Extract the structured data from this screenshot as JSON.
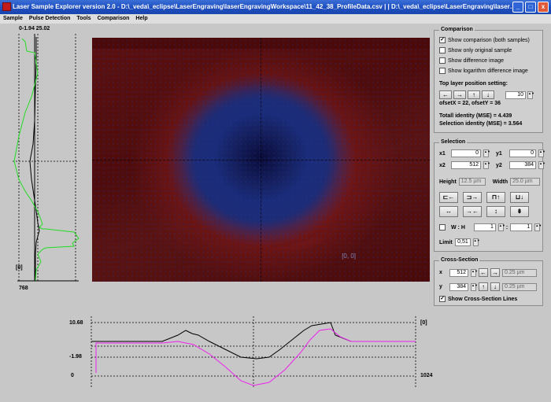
{
  "window": {
    "title": "Laser Sample Explorer version 2.0 - D:\\_veda\\_eclipse\\LaserEngraving\\laserEngravingWorkspace\\11_42_38_ProfileData.csv | | D:\\_veda\\_eclipse\\LaserEngraving\\laserEngravingWorksp...",
    "minimize": "_",
    "maximize": "□",
    "close": "x"
  },
  "menu": [
    "Sample",
    "Pulse Detection",
    "Tools",
    "Comparison",
    "Help"
  ],
  "left_profile": {
    "top_label": "0-1.94 25.02",
    "marker_label": "[0]",
    "bottom_label": "768"
  },
  "image": {
    "origin_label": "[0, 0]"
  },
  "bottom_profile": {
    "y_top": "10.68",
    "y_mid": "-1.98",
    "y_bottom": "0",
    "right_top": "[0]",
    "right_bottom": "1024"
  },
  "comparison": {
    "title": "Comparison",
    "options": [
      {
        "label": "Show comparison (both samples)",
        "checked": true
      },
      {
        "label": "Show only original sample",
        "checked": false
      },
      {
        "label": "Show difference image",
        "checked": false
      },
      {
        "label": "Show logarithm difference image",
        "checked": false
      }
    ],
    "top_layer_label": "Top layer position setting:",
    "step_value": "10",
    "offset_text": "ofsetX = 22, ofsetY = 36",
    "total_identity": "Totall identity (MSE) = 4.439",
    "selection_identity": "Selection identity (MSE) = 3.564"
  },
  "selection": {
    "title": "Selection",
    "x1_label": "x1",
    "x1": "0",
    "y1_label": "y1",
    "y1": "0",
    "x2_label": "x2",
    "x2": "512",
    "y2_label": "y2",
    "y2": "384",
    "height_label": "Height",
    "height": "12.5 µm",
    "width_label": "Width",
    "width": "25.0 µm",
    "wh_label": "W : H",
    "w_value": "1",
    "h_value": "1",
    "wh_separator": ":",
    "limit_label": "Limit",
    "limit": "0,51"
  },
  "cross_section": {
    "title": "Cross-Section",
    "x_label": "x",
    "x": "512",
    "x_um": "0.25 µm",
    "y_label": "y",
    "y": "384",
    "y_um": "0.25 µm",
    "show_lines_label": "Show Cross-Section Lines",
    "show_lines_checked": true
  }
}
